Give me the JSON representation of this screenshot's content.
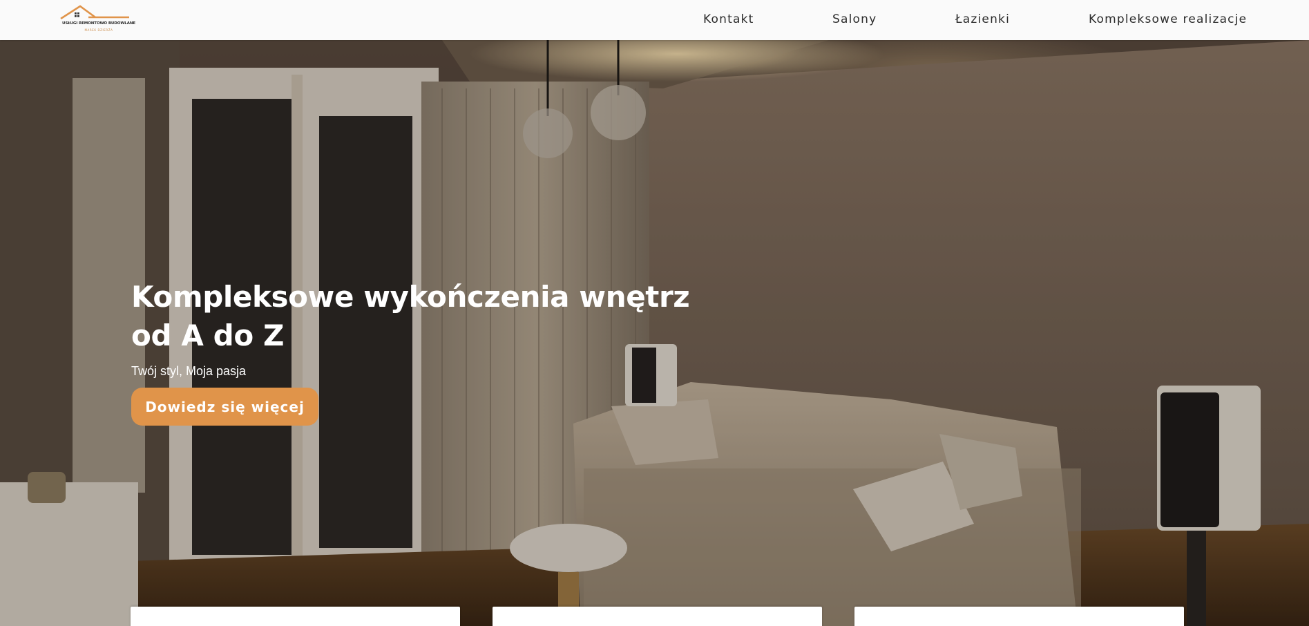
{
  "header": {
    "logo_name": "USŁUGI REMONTOWO BUDOWLANE",
    "logo_sub": "MAREK DZIERŻA",
    "nav": [
      {
        "label": "Kontakt"
      },
      {
        "label": "Salony"
      },
      {
        "label": "Łazienki"
      },
      {
        "label": "Kompleksowe realizacje"
      }
    ]
  },
  "hero": {
    "title_line1": "Kompleksowe wykończenia wnętrz",
    "title_line2": "od A do Z",
    "subtitle": "Twój styl, Moja pasja",
    "cta_label": "Dowiedz się więcej"
  },
  "cards": [
    {
      "label": ""
    },
    {
      "label": ""
    },
    {
      "label": ""
    }
  ],
  "colors": {
    "accent": "#e0944a",
    "header_bg": "#fafafa"
  }
}
